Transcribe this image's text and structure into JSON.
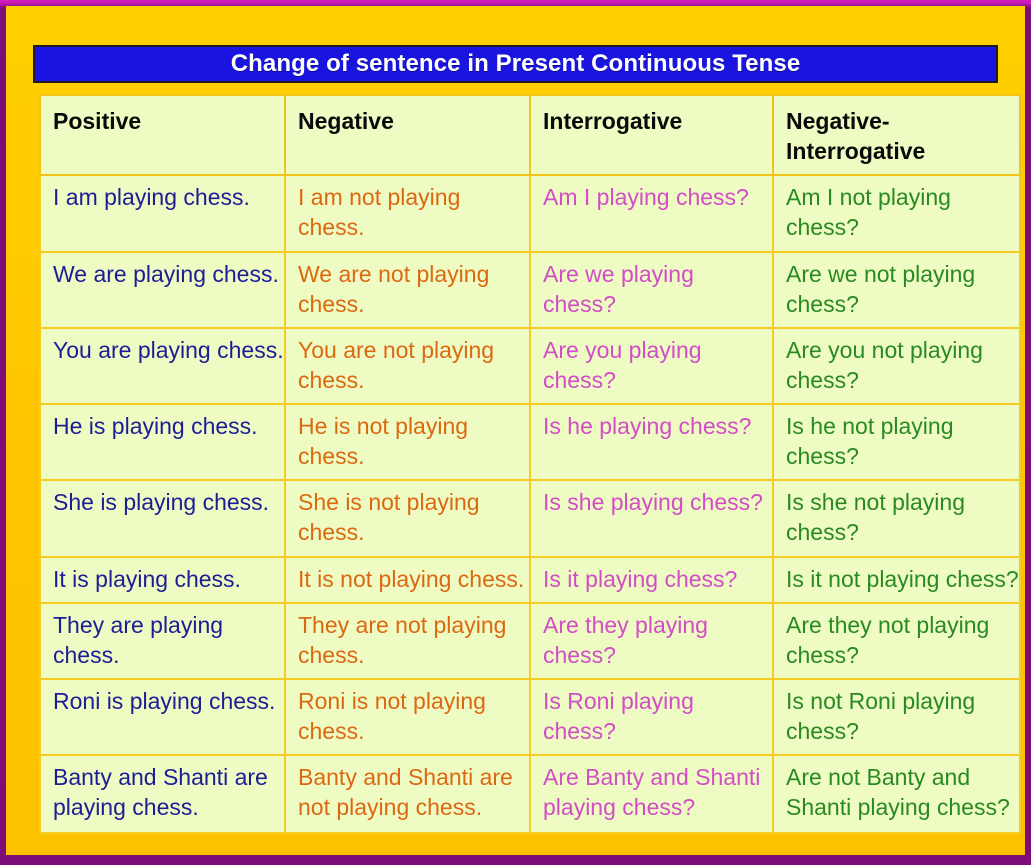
{
  "poster": {
    "title": "Change of sentence in Present Continuous Tense",
    "colors": {
      "outer_border": "#a000a0",
      "frame": "#ffc709",
      "title_background": "#1a14e0",
      "title_text": "#ffffff",
      "cell_background": "#eefbc2",
      "cell_border": "#f5cd22",
      "header_text": "#0a0a0a",
      "positive_text": "#1d1d96",
      "negative_text": "#dd6812",
      "interrogative_text": "#d24dc6",
      "negative_interrogative_text": "#2a8a22"
    }
  },
  "table": {
    "headers": [
      "Positive",
      "Negative",
      "Interrogative",
      "Negative-Interrogative"
    ],
    "rows": [
      {
        "positive": "I am playing chess.",
        "negative": "I am not playing chess.",
        "interrogative": "Am I playing chess?",
        "negative_interrogative": "Am I not playing chess?"
      },
      {
        "positive": "We are playing chess.",
        "negative": "We are not playing chess.",
        "interrogative": "Are we playing chess?",
        "negative_interrogative": "Are we not playing chess?"
      },
      {
        "positive": "You are playing chess.",
        "negative": "You are not playing chess.",
        "interrogative": "Are you playing chess?",
        "negative_interrogative": "Are you not playing chess?"
      },
      {
        "positive": "He is playing chess.",
        "negative": "He is not playing chess.",
        "interrogative": "Is he playing chess?",
        "negative_interrogative": "Is he not playing chess?"
      },
      {
        "positive": "She is playing chess.",
        "negative": "She is not playing chess.",
        "interrogative": "Is she playing chess?",
        "negative_interrogative": "Is she not playing chess?"
      },
      {
        "positive": "It is playing chess.",
        "negative": "It is not playing chess.",
        "interrogative": "Is it playing chess?",
        "negative_interrogative": "Is it not playing chess?"
      },
      {
        "positive": "They are playing chess.",
        "negative": "They are not playing chess.",
        "interrogative": "Are they playing chess?",
        "negative_interrogative": "Are they not playing chess?"
      },
      {
        "positive": "Roni is playing chess.",
        "negative": "Roni is not playing chess.",
        "interrogative": "Is Roni playing chess?",
        "negative_interrogative": "Is not Roni playing chess?"
      },
      {
        "positive": "Banty and Shanti are playing chess.",
        "negative": "Banty and Shanti are not playing chess.",
        "interrogative": "Are Banty and Shanti playing chess?",
        "negative_interrogative": "Are not Banty and Shanti playing chess?"
      }
    ]
  }
}
